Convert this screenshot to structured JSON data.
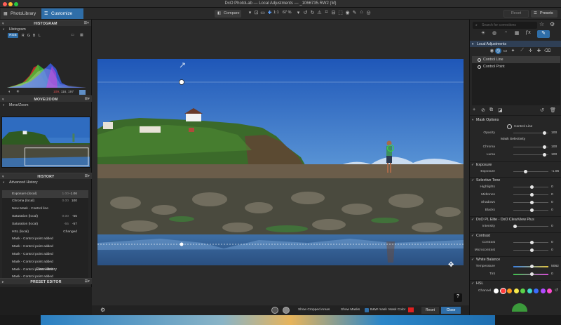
{
  "window": {
    "title": "DxO PhotoLab — Local Adjustments — _1066735.RW2 (M)"
  },
  "tabs": [
    {
      "label": "PhotoLibrary"
    },
    {
      "label": "Customize"
    }
  ],
  "toolbar": {
    "compare_label": "Compare",
    "zoom_fit": "1:1",
    "zoom_percent": "67 %",
    "reset_label": "Reset",
    "presets_label": "Presets"
  },
  "left_panel": {
    "histogram": {
      "title": "HISTOGRAM",
      "subtitle": "Histogram",
      "channels": [
        "RGB",
        "R",
        "G",
        "B",
        "L"
      ],
      "rgb_readout": {
        "r": "109,",
        "rest": "116, 197"
      },
      "swatch_color": "#5f8fc7"
    },
    "move_zoom": {
      "title": "MOVE/ZOOM",
      "subtitle": "Move/Zoom"
    },
    "history": {
      "title": "HISTORY",
      "subtitle": "Advanced History",
      "rows": [
        {
          "label": "Exposure (local)",
          "key": "1.00",
          "value": "-1.06",
          "selected": true
        },
        {
          "label": "Chroma (local)",
          "key": "0.00",
          "value": "100"
        },
        {
          "label": "New Mask - Control line",
          "key": "",
          "value": ""
        },
        {
          "label": "Saturation (local)",
          "key": "0.00",
          "value": "-55"
        },
        {
          "label": "Saturation (local)",
          "key": "-55",
          "value": "-57"
        },
        {
          "label": "HSL (local)",
          "key": "",
          "value": "Changed"
        },
        {
          "label": "Mask - Control point added",
          "key": "",
          "value": ""
        },
        {
          "label": "Mask - Control point added",
          "key": "",
          "value": ""
        },
        {
          "label": "Mask - Control point added",
          "key": "",
          "value": ""
        },
        {
          "label": "Mask - Control point added",
          "key": "",
          "value": ""
        },
        {
          "label": "Mask - Control point added",
          "key": "",
          "value": ""
        },
        {
          "label": "Mask - Control point added",
          "key": "",
          "value": ""
        }
      ],
      "clear_label": "Clear History"
    },
    "preset_editor": {
      "title": "PRESET EDITOR"
    }
  },
  "viewer": {
    "help_label": "?"
  },
  "bottom_bar": {
    "show_cropped_label": "Show Cropped Areas",
    "show_masks_label": "Show Masks",
    "mask_mode_label": "B&W mask",
    "mask_color_label": "Mask Color",
    "mask_color": "#e02020",
    "reset_label": "Reset",
    "close_label": "Close"
  },
  "right_panel": {
    "search_placeholder": "Search for corrections",
    "local_adjustments_title": "Local Adjustments",
    "masks": [
      {
        "label": "Control Line",
        "selected": true
      },
      {
        "label": "Control Point",
        "selected": false
      }
    ],
    "mask_options": {
      "title": "Mask Options",
      "control_line_label": "Control Line",
      "opacity_label": "Opacity",
      "opacity_value": "100",
      "opacity_pos": 0.9,
      "selectivity_title": "Mask Selectivity",
      "chroma_label": "Chroma",
      "chroma_value": "100",
      "chroma_pos": 0.9,
      "luma_label": "Luma",
      "luma_value": "100",
      "luma_pos": 0.9
    },
    "exposure": {
      "title": "Exposure",
      "label": "Exposure",
      "value": "-1.06",
      "pos": 0.32
    },
    "selective_tone": {
      "title": "Selective Tone",
      "rows": [
        {
          "label": "Highlights",
          "value": "0",
          "pos": 0.5
        },
        {
          "label": "Midtones",
          "value": "0",
          "pos": 0.5
        },
        {
          "label": "Shadows",
          "value": "0",
          "pos": 0.5
        },
        {
          "label": "Blacks",
          "value": "0",
          "pos": 0.5
        }
      ]
    },
    "clearview": {
      "title": "DxO PL Elite - DxO ClearView Plus",
      "label": "Intensity",
      "value": "0",
      "pos": 0.0
    },
    "contrast": {
      "title": "Contrast",
      "rows": [
        {
          "label": "Contrast",
          "value": "0",
          "pos": 0.5
        },
        {
          "label": "Microcontrast",
          "value": "0",
          "pos": 0.5
        }
      ]
    },
    "white_balance": {
      "title": "White Balance",
      "temperature_label": "Temperature",
      "temperature_value": "5062",
      "temperature_pos": 0.5,
      "tint_label": "Tint",
      "tint_value": "0",
      "tint_pos": 0.5
    },
    "hsl": {
      "title": "HSL",
      "channel_label": "Channel",
      "swatches": [
        "#ffffff",
        "#ff3b3b",
        "#ff9a1f",
        "#f6e84a",
        "#5bd34a",
        "#3fd8c9",
        "#3b6dff",
        "#b04cff",
        "#ff4cd0"
      ]
    }
  }
}
